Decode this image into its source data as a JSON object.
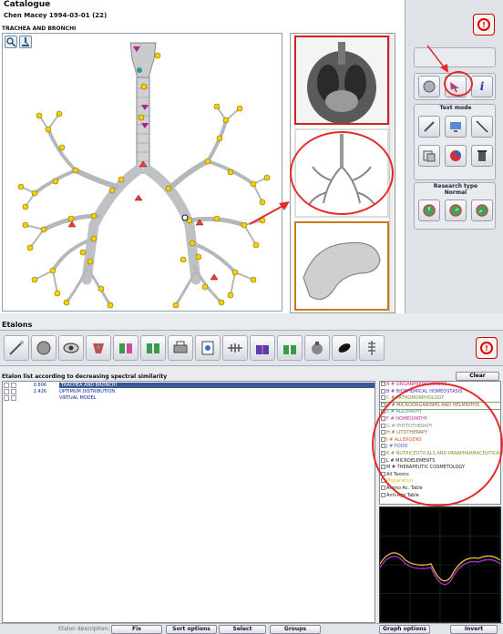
{
  "catalogue": {
    "title": "Catalogue",
    "patient": "Chen Macey  1994-03-01 (22)",
    "organ": "TRACHEA AND BRONCHI"
  },
  "right_panel": {
    "text_mode": "Text mode",
    "research_type": "Research type",
    "research_value": "Normal"
  },
  "etalons": {
    "title": "Etalons",
    "list_header": "Etalon list according to decreasing spectral similarity",
    "clear_label": "Clear",
    "rows": [
      {
        "value": "0.806",
        "name": "TRACHEA  AND  BRONCHI"
      },
      {
        "value": "2.426",
        "name": "OPTIMUM DISTRIBUTION"
      },
      {
        "value": "",
        "name": "VIRTUAL MODEL"
      }
    ]
  },
  "categories": [
    {
      "label": "A # ORGANPREPARATIONS",
      "color": "#e0207a"
    },
    {
      "label": "B # BIOCHEMICAL HOMEOSTASIS",
      "color": "#5a2ad0"
    },
    {
      "label": "C # PATHOMORPHOLOGY",
      "color": "#6b8e23"
    },
    {
      "label": "D # MICROORGANISMS AND HELMINTHS",
      "color": "#a0522d"
    },
    {
      "label": "E # ALLOPATHY",
      "color": "#2f8f8f"
    },
    {
      "label": "F # HOMEOPATHY",
      "color": "#c0309a"
    },
    {
      "label": "G # PHYTOTHERAPY",
      "color": "#7a8f9a"
    },
    {
      "label": "H # LITOTHERAPY",
      "color": "#8a6a3a"
    },
    {
      "label": "I # ALLERGENS",
      "color": "#d86020"
    },
    {
      "label": "J # FOOD",
      "color": "#3060c0"
    },
    {
      "label": "K # NUTRICEUTICALS AND PARAPHARMACEUTICALS",
      "color": "#8a8a2a"
    },
    {
      "label": "L # MICROELEMENTS",
      "color": "#222222"
    },
    {
      "label": "M # THERAPEUTIC COSMETOLOGY",
      "color": "#222222"
    },
    {
      "label": "All Taxons",
      "color": "#222222"
    },
    {
      "label": "Preparation",
      "color": "#d8c010"
    },
    {
      "label": "Amino Ac. Table",
      "color": "#222222"
    },
    {
      "label": "Anti-Age Table",
      "color": "#222222"
    }
  ],
  "bottom": {
    "etalon_description": "Etalon description:",
    "fix": "Fix",
    "sort_options": "Sort options",
    "select": "Select",
    "groups": "Groups",
    "graph_options": "Graph options",
    "invert": "Invert"
  },
  "colors": {
    "annotation": "#e32b2b",
    "selection": "#3a5a96",
    "graph_yellow": "#e8c040",
    "graph_purple": "#b030d0"
  }
}
